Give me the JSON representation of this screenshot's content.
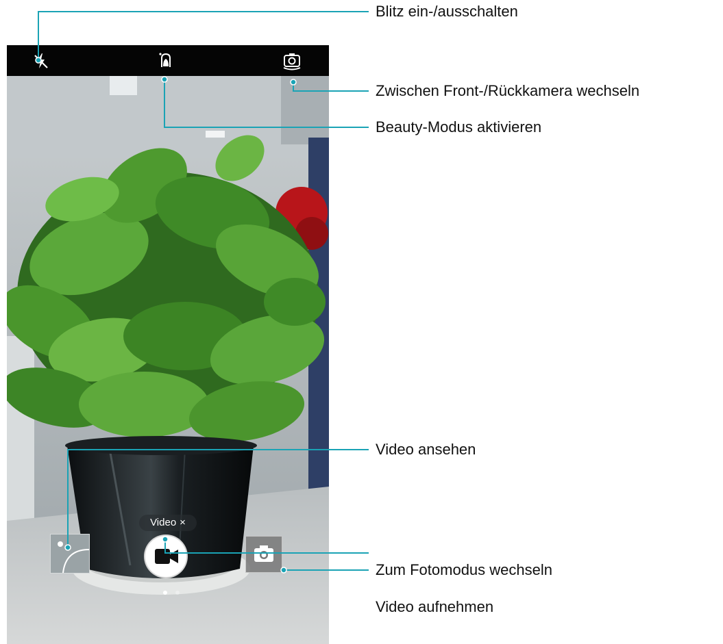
{
  "callouts": {
    "flash": "Blitz ein-/ausschalten",
    "switch_camera": "Zwischen Front-/Rückkamera wechseln",
    "beauty": "Beauty-Modus aktivieren",
    "view_video": "Video ansehen",
    "photo_mode": "Zum Fotomodus wechseln",
    "record": "Video aufnehmen"
  },
  "camera": {
    "mode_chip": "Video",
    "mode_chip_close": "×",
    "top_icons": [
      "flash-off-icon",
      "beauty-icon",
      "switch-camera-icon"
    ],
    "bottom_icons": [
      "gallery-thumbnail",
      "video-record-icon",
      "camera-icon"
    ]
  },
  "colors": {
    "callout_line": "#1aa3b5",
    "topbar": "#050505"
  }
}
